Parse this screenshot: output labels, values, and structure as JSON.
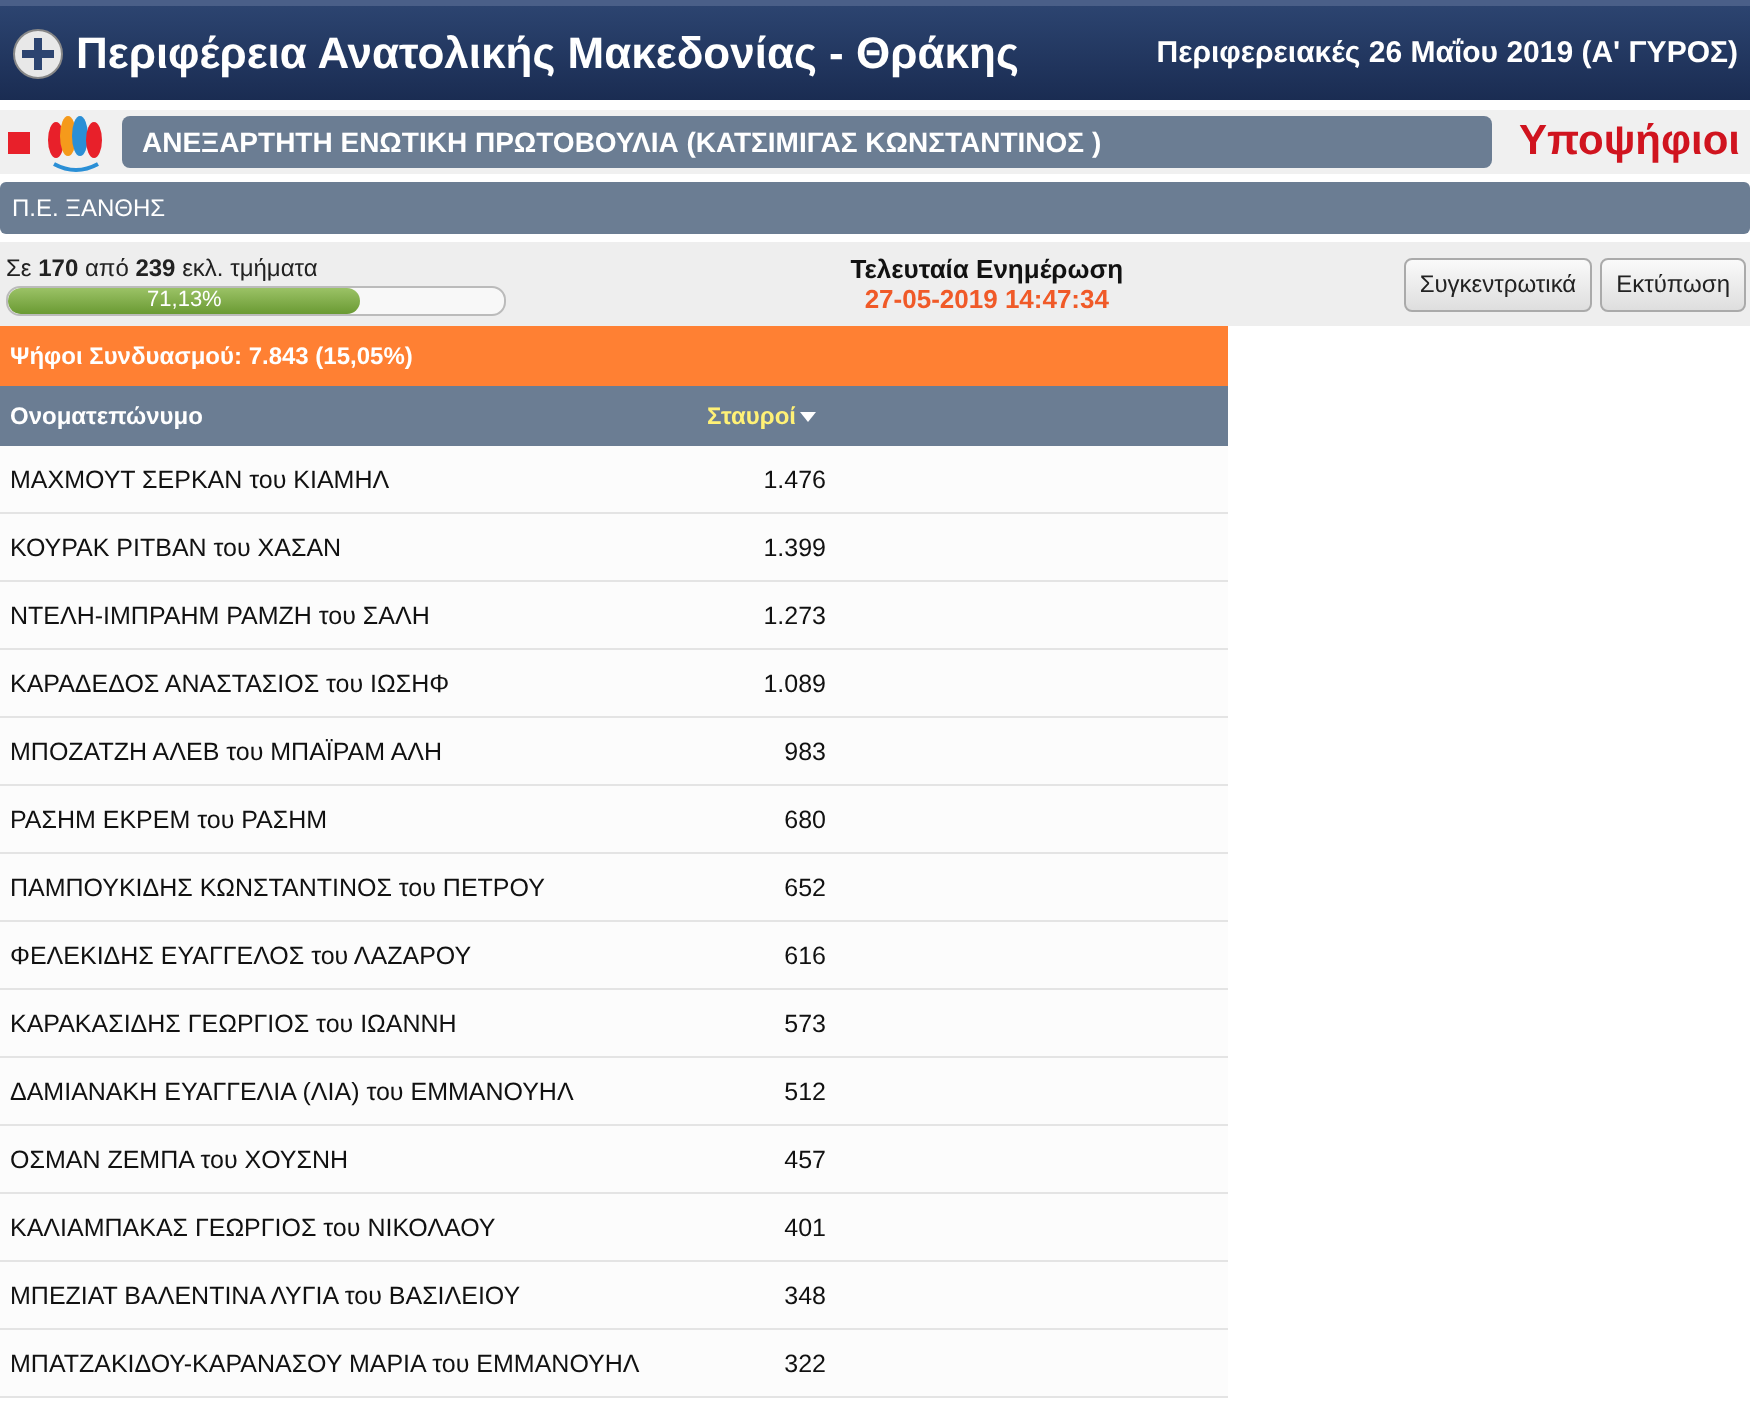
{
  "header": {
    "title": "Περιφέρεια Ανατολικής Μακεδονίας - Θράκης",
    "election": "Περιφερειακές 26 Μαΐου 2019 (Α' ΓΥΡΟΣ)"
  },
  "party": {
    "color": "#e8202a",
    "name": "ΑΝΕΞΑΡΤΗΤΗ ΕΝΩΤΙΚΗ ΠΡΩΤΟΒΟΥΛΙΑ (ΚΑΤΣΙΜΙΓΑΣ ΚΩΝΣΤΑΝΤΙΝΟΣ )",
    "section": "Υποψήφιοι"
  },
  "region": "Π.Ε. ΞΑΝΘΗΣ",
  "progress": {
    "text": "Σε **170** από **239** εκλ. τμήματα",
    "level": 0.7113,
    "reading": "71,13%"
  },
  "update": {
    "label": "Τελευταία Ενημέρωση",
    "time": "27-05-2019 14:47:34"
  },
  "buttons": [
    "Συγκεντρωτικά",
    "Εκτύπωση"
  ],
  "votes_bar": "Ψήφοι Συνδυασμού: 7.843 (15,05%)",
  "table": {
    "columns": [
      {
        "label": "Ονοματεπώνυμο",
        "sorted": false
      },
      {
        "label": "Σταυροί",
        "sorted": true
      }
    ],
    "rows": [
      {
        "name": "ΜΑΧΜΟΥΤ ΣΕΡΚΑΝ του ΚΙΑΜΗΛ",
        "votes": "1.476"
      },
      {
        "name": "ΚΟΥΡΑΚ ΡΙΤΒΑΝ του ΧΑΣΑΝ",
        "votes": "1.399"
      },
      {
        "name": "ΝΤΕΛΗ-ΙΜΠΡΑΗΜ ΡΑΜΖΗ του ΣΑΛΗ",
        "votes": "1.273"
      },
      {
        "name": "ΚΑΡΑΔΕΔΟΣ ΑΝΑΣΤΑΣΙΟΣ του ΙΩΣΗΦ",
        "votes": "1.089"
      },
      {
        "name": "ΜΠΟΖΑΤΖΗ ΑΛΕΒ του ΜΠΑΪΡΑΜ ΑΛΗ",
        "votes": "983"
      },
      {
        "name": "ΡΑΣΗΜ ΕΚΡΕΜ του ΡΑΣΗΜ",
        "votes": "680"
      },
      {
        "name": "ΠΑΜΠΟΥΚΙΔΗΣ ΚΩΝΣΤΑΝΤΙΝΟΣ του ΠΕΤΡΟΥ",
        "votes": "652"
      },
      {
        "name": "ΦΕΛΕΚΙΔΗΣ ΕΥΑΓΓΕΛΟΣ του ΛΑΖΑΡΟΥ",
        "votes": "616"
      },
      {
        "name": "ΚΑΡΑΚΑΣΙΔΗΣ ΓΕΩΡΓΙΟΣ του ΙΩΑΝΝΗ",
        "votes": "573"
      },
      {
        "name": "ΔΑΜΙΑΝΑΚΗ ΕΥΑΓΓΕΛΙΑ (ΛΙΑ) του ΕΜΜΑΝΟΥΗΛ",
        "votes": "512"
      },
      {
        "name": "ΟΣΜΑΝ ΖΕΜΠΑ του ΧΟΥΣΝΗ",
        "votes": "457"
      },
      {
        "name": "ΚΑΛΙΑΜΠΑΚΑΣ ΓΕΩΡΓΙΟΣ του ΝΙΚΟΛΑΟΥ",
        "votes": "401"
      },
      {
        "name": "ΜΠΕΖΙΑΤ ΒΑΛΕΝΤΙΝΑ ΛΥΓΙΑ του ΒΑΣΙΛΕΙΟΥ",
        "votes": "348"
      },
      {
        "name": "ΜΠΑΤΖΑΚΙΔΟΥ-ΚΑΡΑΝΑΣΟΥ ΜΑΡΙΑ του ΕΜΜΑΝΟΥΗΛ",
        "votes": "322"
      }
    ]
  }
}
